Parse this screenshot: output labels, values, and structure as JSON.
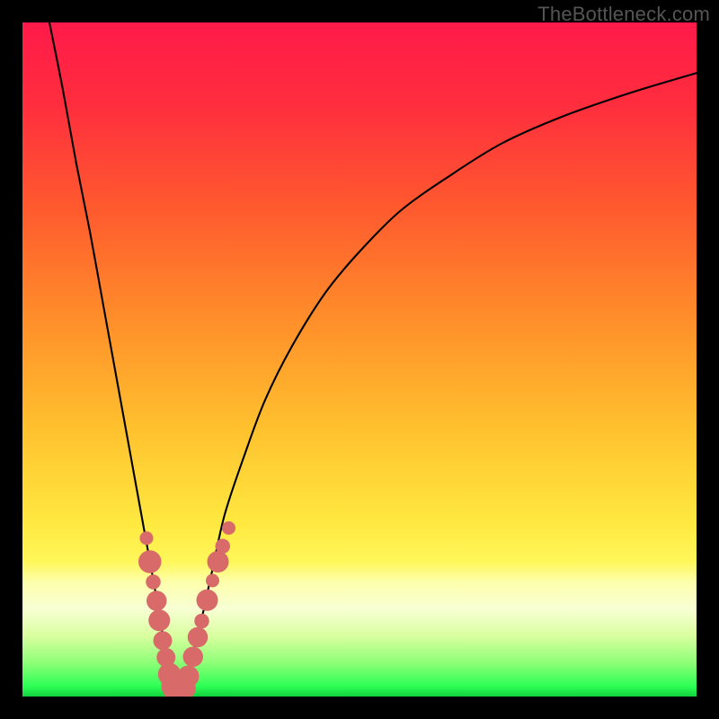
{
  "watermark": "TheBottleneck.com",
  "gradient": {
    "stops": [
      {
        "offset": 0.0,
        "color": "#ff1a4a"
      },
      {
        "offset": 0.12,
        "color": "#ff2d3e"
      },
      {
        "offset": 0.28,
        "color": "#ff5b2e"
      },
      {
        "offset": 0.44,
        "color": "#ff8e2a"
      },
      {
        "offset": 0.6,
        "color": "#ffc02e"
      },
      {
        "offset": 0.74,
        "color": "#ffe83f"
      },
      {
        "offset": 0.8,
        "color": "#fff75a"
      },
      {
        "offset": 0.83,
        "color": "#fdffab"
      },
      {
        "offset": 0.87,
        "color": "#f8ffd4"
      },
      {
        "offset": 0.91,
        "color": "#d9ff9f"
      },
      {
        "offset": 0.95,
        "color": "#8eff78"
      },
      {
        "offset": 0.985,
        "color": "#2cff55"
      },
      {
        "offset": 1.0,
        "color": "#11d13e"
      }
    ]
  },
  "chart_data": {
    "type": "line",
    "title": "",
    "xlabel": "",
    "ylabel": "",
    "xlim": [
      0,
      100
    ],
    "ylim": [
      0,
      100
    ],
    "series": [
      {
        "name": "bottleneck-curve",
        "x": [
          4,
          6,
          8,
          10,
          12,
          14,
          16,
          18,
          20,
          21,
          22,
          23,
          24,
          26,
          28,
          30,
          33,
          36,
          40,
          45,
          50,
          56,
          63,
          71,
          80,
          90,
          100
        ],
        "y": [
          100,
          90,
          79,
          69,
          58,
          47,
          36,
          25,
          14,
          8,
          3,
          0.2,
          2,
          9,
          18,
          27,
          36,
          44,
          52,
          60,
          66,
          72,
          77,
          82,
          86,
          89.5,
          92.5
        ]
      }
    ],
    "markers": [
      {
        "name": "highlight-points-left",
        "color": "#d96a6a",
        "points": [
          {
            "x": 18.4,
            "y": 23.5,
            "r": 1.0
          },
          {
            "x": 18.9,
            "y": 20.0,
            "r": 1.7
          },
          {
            "x": 19.4,
            "y": 17.0,
            "r": 1.1
          },
          {
            "x": 19.9,
            "y": 14.2,
            "r": 1.5
          },
          {
            "x": 20.3,
            "y": 11.3,
            "r": 1.6
          },
          {
            "x": 20.8,
            "y": 8.3,
            "r": 1.4
          },
          {
            "x": 21.3,
            "y": 5.8,
            "r": 1.4
          }
        ]
      },
      {
        "name": "highlight-bottom",
        "color": "#d96a6a",
        "points": [
          {
            "x": 21.8,
            "y": 3.3,
            "r": 1.7
          },
          {
            "x": 22.3,
            "y": 1.5,
            "r": 1.7
          },
          {
            "x": 22.8,
            "y": 0.5,
            "r": 1.8
          },
          {
            "x": 23.4,
            "y": 0.3,
            "r": 1.8
          },
          {
            "x": 24.0,
            "y": 1.2,
            "r": 1.7
          },
          {
            "x": 24.6,
            "y": 3.0,
            "r": 1.6
          }
        ]
      },
      {
        "name": "highlight-points-right",
        "color": "#d96a6a",
        "points": [
          {
            "x": 25.3,
            "y": 5.9,
            "r": 1.5
          },
          {
            "x": 26.0,
            "y": 8.8,
            "r": 1.5
          },
          {
            "x": 26.6,
            "y": 11.2,
            "r": 1.1
          },
          {
            "x": 27.4,
            "y": 14.3,
            "r": 1.6
          },
          {
            "x": 28.2,
            "y": 17.2,
            "r": 1.0
          },
          {
            "x": 29.0,
            "y": 20.0,
            "r": 1.6
          },
          {
            "x": 29.7,
            "y": 22.3,
            "r": 1.1
          },
          {
            "x": 30.6,
            "y": 25.0,
            "r": 1.0
          }
        ]
      }
    ]
  }
}
